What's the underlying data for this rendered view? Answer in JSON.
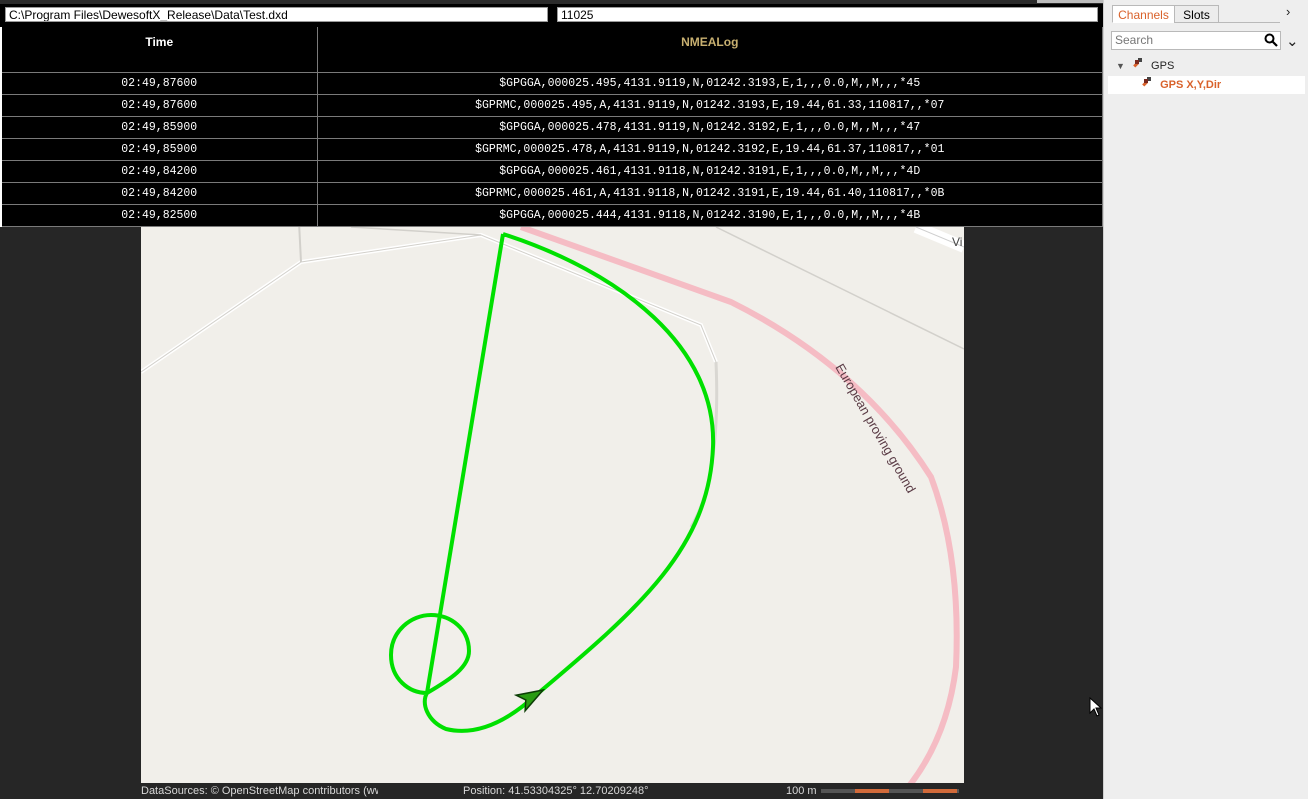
{
  "header": {
    "file_path": "C:\\Program Files\\DewesoftX_Release\\Data\\Test.dxd",
    "value": "11025"
  },
  "log": {
    "columns": [
      "Time",
      "NMEALog"
    ],
    "rows": [
      {
        "time": "02:49,87600",
        "msg": "$GPGGA,000025.495,4131.9119,N,01242.3193,E,1,,,0.0,M,,M,,,*45"
      },
      {
        "time": "02:49,87600",
        "msg": "$GPRMC,000025.495,A,4131.9119,N,01242.3193,E,19.44,61.33,110817,,*07"
      },
      {
        "time": "02:49,85900",
        "msg": "$GPGGA,000025.478,4131.9119,N,01242.3192,E,1,,,0.0,M,,M,,,*47"
      },
      {
        "time": "02:49,85900",
        "msg": "$GPRMC,000025.478,A,4131.9119,N,01242.3192,E,19.44,61.37,110817,,*01"
      },
      {
        "time": "02:49,84200",
        "msg": "$GPGGA,000025.461,4131.9118,N,01242.3191,E,1,,,0.0,M,,M,,,*4D"
      },
      {
        "time": "02:49,84200",
        "msg": "$GPRMC,000025.461,A,4131.9118,N,01242.3191,E,19.44,61.40,110817,,*0B"
      },
      {
        "time": "02:49,82500",
        "msg": "$GPGGA,000025.444,4131.9118,N,01242.3190,E,1,,,0.0,M,,M,,,*4B"
      }
    ]
  },
  "map": {
    "road_label": "European proving ground",
    "corner_label": "Vi",
    "attribution": "DataSources: © OpenStreetMap contributors (ww",
    "position": "Position: 41.53304325° 12.70209248°",
    "scale_label": "100 m",
    "track_color": "#00e000",
    "road_color": "#f5bcc4"
  },
  "panel": {
    "tabs": [
      "Channels",
      "Slots"
    ],
    "search_placeholder": "Search",
    "tree": {
      "group": "GPS",
      "selected_item": "GPS X,Y,Dir"
    },
    "accent_color": "#d9622b"
  }
}
